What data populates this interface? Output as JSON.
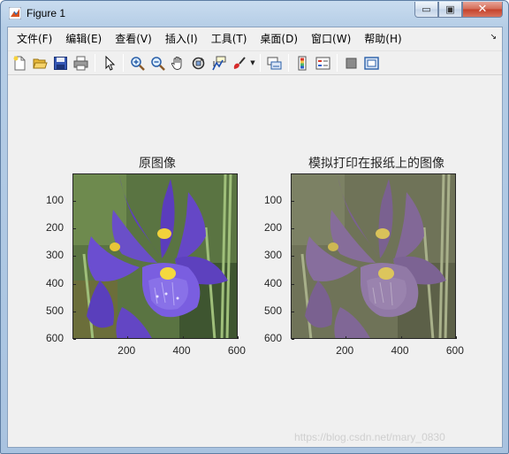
{
  "window": {
    "title": "Figure 1",
    "buttons": {
      "minimize": "▭",
      "maximize": "▣",
      "close": "✕"
    }
  },
  "menu": [
    "文件(F)",
    "编辑(E)",
    "查看(V)",
    "插入(I)",
    "工具(T)",
    "桌面(D)",
    "窗口(W)",
    "帮助(H)"
  ],
  "toolbar_icons": [
    "new-figure-icon",
    "open-file-icon",
    "save-icon",
    "print-icon",
    "edit-plot-pointer-icon",
    "zoom-in-icon",
    "zoom-out-icon",
    "pan-hand-icon",
    "rotate-3d-icon",
    "data-cursor-icon",
    "brush-icon",
    "link-plot-icon",
    "insert-colorbar-icon",
    "insert-legend-icon",
    "hide-plot-tools-icon",
    "show-plot-tools-icon"
  ],
  "axes": [
    {
      "title": "原图像",
      "yticks": [
        "100",
        "200",
        "300",
        "400",
        "500",
        "600"
      ],
      "xticks": [
        "200",
        "400",
        "600"
      ],
      "image": "iris-flower-original"
    },
    {
      "title": "模拟打印在报纸上的图像",
      "yticks": [
        "100",
        "200",
        "300",
        "400",
        "500",
        "600"
      ],
      "xticks": [
        "200",
        "400",
        "600"
      ],
      "image": "iris-flower-newsprint-simulation"
    }
  ],
  "watermark": "https://blog.csdn.net/mary_0830",
  "colors": {
    "titlebar": "#b5cde6",
    "figure_bg": "#f0f0f0",
    "petal_purple": "#6a4fc8",
    "faded_purple": "#8a6f98",
    "close_red": "#c4412a"
  }
}
